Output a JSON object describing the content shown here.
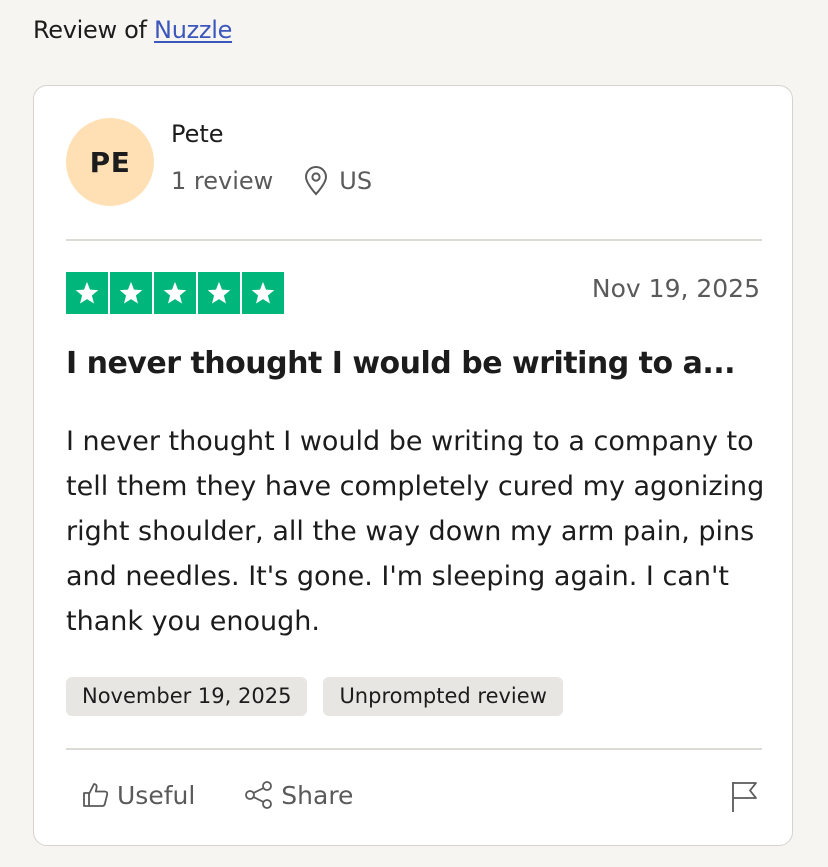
{
  "header": {
    "prefix": "Review of",
    "company": "Nuzzle"
  },
  "reviewer": {
    "initials": "PE",
    "name": "Pete",
    "review_count": "1 review",
    "country": "US"
  },
  "review": {
    "rating": 5,
    "date": "Nov 19, 2025",
    "title": "I never thought I would be writing to a...",
    "body": "I never thought I would be writing to a company to tell them they have completely cured my agonizing right shoulder, all the way down my arm pain, pins and needles. It's gone. I'm sleeping again. I can't thank you enough.",
    "tags": [
      "November 19, 2025",
      "Unprompted review"
    ]
  },
  "actions": {
    "useful_label": "Useful",
    "share_label": "Share"
  },
  "colors": {
    "star_bg": "#00b67a",
    "avatar_bg": "#ffe0b5",
    "link": "#3c57bc"
  }
}
